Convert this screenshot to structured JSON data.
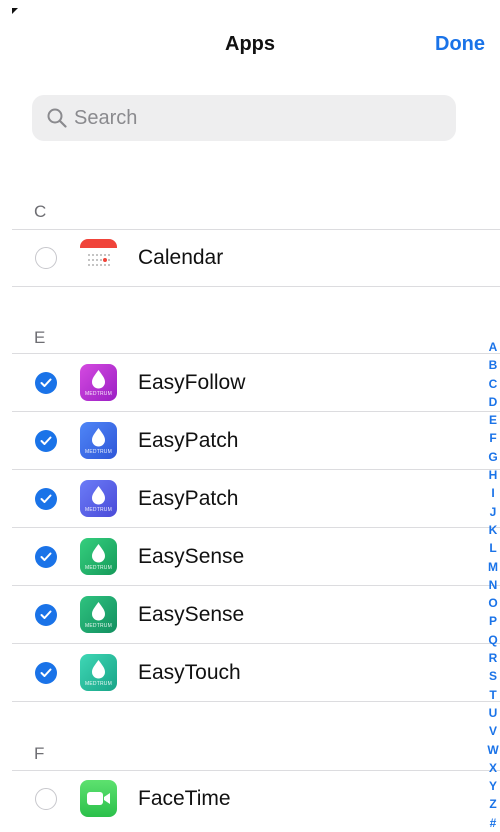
{
  "nav": {
    "title": "Apps",
    "done_label": "Done"
  },
  "search": {
    "placeholder": "Search"
  },
  "sections": [
    {
      "header": "C",
      "rows": [
        {
          "label": "Calendar",
          "checked": false,
          "icon": "calendar-app-icon"
        }
      ]
    },
    {
      "header": "E",
      "rows": [
        {
          "label": "EasyFollow",
          "checked": true,
          "icon": "easyfollow-app-icon",
          "brand": "MEDTRUM",
          "color": "#c02bd0"
        },
        {
          "label": "EasyPatch",
          "checked": true,
          "icon": "easypatch-app-icon",
          "brand": "MEDTRUM",
          "color": "#3d6ef0"
        },
        {
          "label": "EasyPatch",
          "checked": true,
          "icon": "easypatch-app-icon",
          "brand": "MEDTRUM",
          "color": "#5a5ff0"
        },
        {
          "label": "EasySense",
          "checked": true,
          "icon": "easysense-app-icon",
          "brand": "MEDTRUM",
          "color": "#1fb86c"
        },
        {
          "label": "EasySense",
          "checked": true,
          "icon": "easysense-app-icon",
          "brand": "MEDTRUM",
          "color": "#1aa670"
        },
        {
          "label": "EasyTouch",
          "checked": true,
          "icon": "easytouch-app-icon",
          "brand": "MEDTRUM",
          "color": "#28c6a5"
        }
      ]
    },
    {
      "header": "F",
      "rows": [
        {
          "label": "FaceTime",
          "checked": false,
          "icon": "facetime-app-icon"
        }
      ]
    }
  ],
  "index_letters": [
    "A",
    "B",
    "C",
    "D",
    "E",
    "F",
    "G",
    "H",
    "I",
    "J",
    "K",
    "L",
    "M",
    "N",
    "O",
    "P",
    "Q",
    "R",
    "S",
    "T",
    "U",
    "V",
    "W",
    "X",
    "Y",
    "Z",
    "#"
  ],
  "colors": {
    "accent": "#1a73e8",
    "calendar_red": "#f0443a",
    "facetime_green": "#34c759"
  }
}
